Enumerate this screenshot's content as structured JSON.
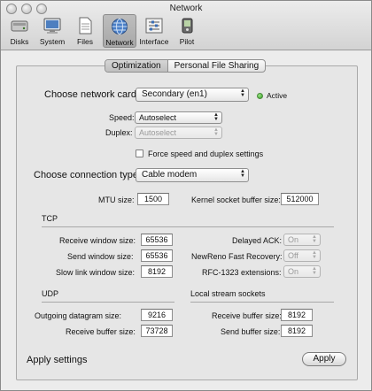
{
  "window": {
    "title": "Network"
  },
  "toolbar": {
    "items": [
      {
        "label": "Disks",
        "icon": "disk-icon"
      },
      {
        "label": "System",
        "icon": "monitor-icon"
      },
      {
        "label": "Files",
        "icon": "document-icon"
      },
      {
        "label": "Network",
        "icon": "globe-icon",
        "selected": true
      },
      {
        "label": "Interface",
        "icon": "sliders-icon"
      },
      {
        "label": "Pilot",
        "icon": "pilot-icon"
      }
    ]
  },
  "tabs": [
    {
      "label": "Optimization",
      "active": true
    },
    {
      "label": "Personal File Sharing",
      "active": false
    }
  ],
  "network": {
    "card_label": "Choose network card:",
    "card_value": "Secondary (en1)",
    "status": "Active",
    "status_color": "#2f9a1e",
    "speed_label": "Speed:",
    "speed_value": "Autoselect",
    "duplex_label": "Duplex:",
    "duplex_value": "Autoselect",
    "force_label": "Force speed and duplex settings",
    "force_checked": false,
    "conn_label": "Choose connection type:",
    "conn_value": "Cable modem",
    "mtu_label": "MTU size:",
    "mtu_value": "1500",
    "kernel_label": "Kernel socket buffer size:",
    "kernel_value": "512000"
  },
  "tcp": {
    "heading": "TCP",
    "receive_label": "Receive window size:",
    "receive_value": "65536",
    "send_label": "Send window size:",
    "send_value": "65536",
    "slowlink_label": "Slow link window size:",
    "slowlink_value": "8192",
    "delayed_label": "Delayed ACK:",
    "delayed_value": "On",
    "newreno_label": "NewReno Fast Recovery:",
    "newreno_value": "Off",
    "rfc_label": "RFC-1323 extensions:",
    "rfc_value": "On"
  },
  "udp": {
    "heading": "UDP",
    "outgoing_label": "Outgoing datagram size:",
    "outgoing_value": "9216",
    "receive_label": "Receive buffer size:",
    "receive_value": "73728"
  },
  "local": {
    "heading": "Local stream sockets",
    "receive_label": "Receive buffer size:",
    "receive_value": "8192",
    "send_label": "Send buffer size:",
    "send_value": "8192"
  },
  "footer": {
    "apply_label": "Apply settings",
    "apply_button": "Apply"
  }
}
